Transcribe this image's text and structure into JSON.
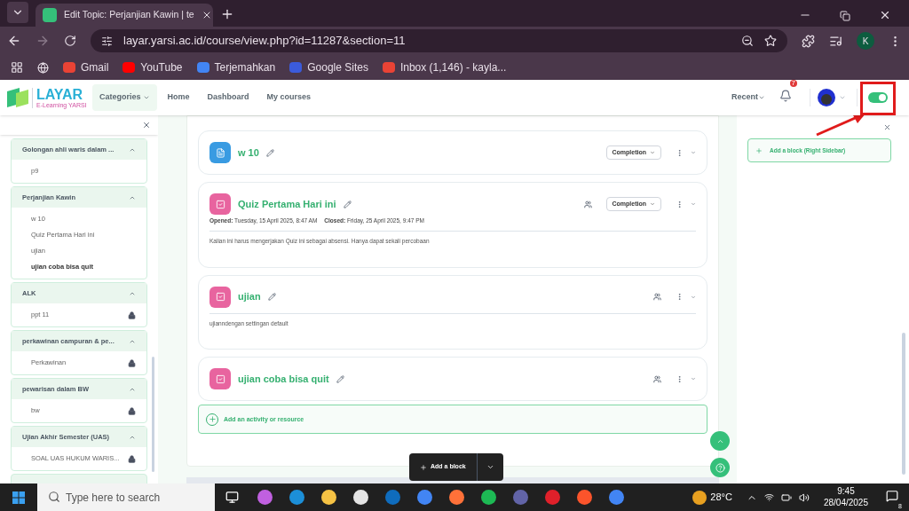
{
  "browser": {
    "tab_title": "Edit Topic: Perjanjian Kawin | te",
    "url": "layar.yarsi.ac.id/course/view.php?id=11287&section=11",
    "profile_initial": "K",
    "bookmarks": [
      {
        "label": "Gmail",
        "color": "#ea4335"
      },
      {
        "label": "YouTube",
        "color": "#ff0000"
      },
      {
        "label": "Terjemahkan",
        "color": "#4285f4"
      },
      {
        "label": "Google Sites",
        "color": "#3b5bdb"
      },
      {
        "label": "Inbox (1,146) - kayla...",
        "color": "#ea4335"
      }
    ]
  },
  "navbar": {
    "logo_title": "LAYAR",
    "logo_subtitle": "E-Learning YARSI",
    "links": [
      {
        "label": "Categories",
        "selected": true
      },
      {
        "label": "Home",
        "selected": false
      },
      {
        "label": "Dashboard",
        "selected": false
      },
      {
        "label": "My courses",
        "selected": false
      }
    ],
    "recent": "Recent",
    "notification_count": "7",
    "edit_mode": {
      "on": true
    }
  },
  "course_index": {
    "sections": [
      {
        "title": "Golongan ahli waris dalam ...",
        "expanded": true,
        "items": [
          {
            "label": "p9",
            "locked": false,
            "current": false
          }
        ]
      },
      {
        "title": "Perjanjian Kawin",
        "expanded": true,
        "items": [
          {
            "label": "w 10",
            "locked": false,
            "current": false
          },
          {
            "label": "Quiz Pertama Hari ini",
            "locked": false,
            "current": false
          },
          {
            "label": "ujian",
            "locked": false,
            "current": false
          },
          {
            "label": "ujian coba bisa quit",
            "locked": false,
            "current": true
          }
        ]
      },
      {
        "title": "ALK",
        "expanded": true,
        "items": [
          {
            "label": "ppt 11",
            "locked": true,
            "current": false
          }
        ]
      },
      {
        "title": "perkawinan campuran & pe...",
        "expanded": true,
        "items": [
          {
            "label": "Perkawinan",
            "locked": true,
            "current": false
          }
        ]
      },
      {
        "title": "pewarisan dalam BW",
        "expanded": true,
        "items": [
          {
            "label": "bw",
            "locked": true,
            "current": false
          }
        ]
      },
      {
        "title": "Ujian Akhir Semester (UAS)",
        "expanded": true,
        "items": [
          {
            "label": "SOAL UAS HUKUM WARIS...",
            "locked": true,
            "current": false
          }
        ]
      }
    ]
  },
  "activities": [
    {
      "kind": "page",
      "name": "w 10",
      "completion": "Completion",
      "group_mode": false
    },
    {
      "kind": "quiz",
      "name": "Quiz Pertama Hari ini",
      "completion": "Completion",
      "group_mode": true,
      "opened_label": "Opened:",
      "opened": "Tuesday, 15 April 2025, 8:47 AM",
      "closed_label": "Closed:",
      "closed": "Friday, 25 April 2025, 9:47 PM",
      "description": "Kalian ini harus mengerjakan Quiz ini sebagai absensi. Hanya dapat sekali percobaan"
    },
    {
      "kind": "quiz",
      "name": "ujian",
      "group_mode": true,
      "description": "ujianndengan settingan default"
    },
    {
      "kind": "quiz",
      "name": "ujian coba bisa quit",
      "group_mode": true
    }
  ],
  "add_activity": "Add an activity or resource",
  "add_block_button": "Add a block",
  "right_drawer": {
    "add_block": "Add a block (Right Sidebar)"
  },
  "taskbar": {
    "search_placeholder": "Type here to search",
    "temperature": "28°C",
    "time": "9:45",
    "date": "28/04/2025",
    "notification_count": "8"
  }
}
